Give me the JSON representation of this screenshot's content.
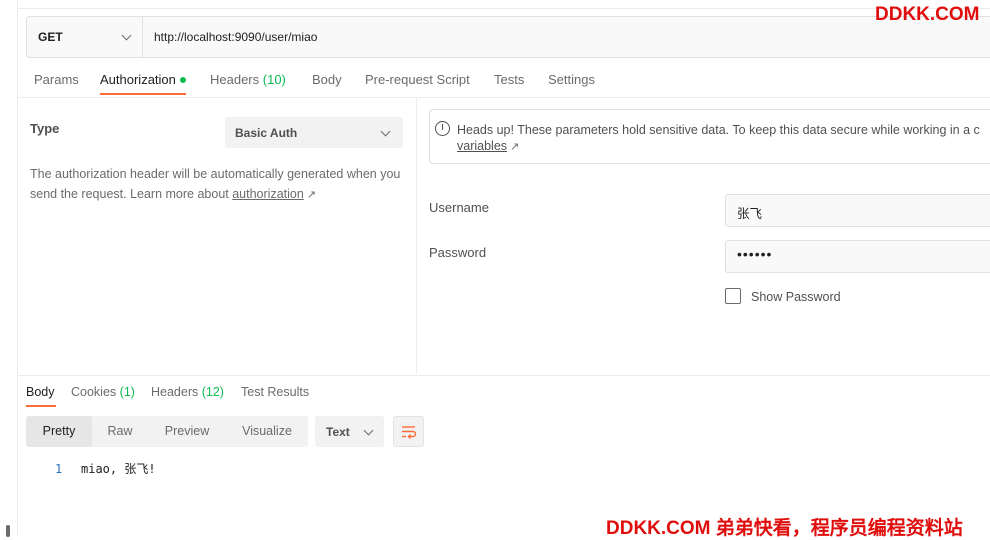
{
  "request": {
    "method": "GET",
    "url": "http://localhost:9090/user/miao"
  },
  "request_tabs": [
    {
      "label": "Params"
    },
    {
      "label": "Authorization",
      "active": true,
      "indicator": "green-dot"
    },
    {
      "label": "Headers",
      "count": "(10)"
    },
    {
      "label": "Body"
    },
    {
      "label": "Pre-request Script"
    },
    {
      "label": "Tests"
    },
    {
      "label": "Settings"
    }
  ],
  "auth": {
    "type_label": "Type",
    "type_value": "Basic Auth",
    "description": "The authorization header will be automatically generated when you send the request. Learn more about ",
    "description_link": "authorization",
    "heads_up_text": "Heads up! These parameters hold sensitive data. To keep this data secure while working in a c",
    "heads_up_link": "variables",
    "username_label": "Username",
    "username_value": "张飞",
    "password_label": "Password",
    "password_value": "••••••",
    "show_password_label": "Show Password"
  },
  "response": {
    "tabs": [
      {
        "label": "Body",
        "active": true
      },
      {
        "label": "Cookies",
        "count": "(1)"
      },
      {
        "label": "Headers",
        "count": "(12)"
      },
      {
        "label": "Test Results"
      }
    ],
    "views": [
      "Pretty",
      "Raw",
      "Preview",
      "Visualize"
    ],
    "active_view": "Pretty",
    "format": "Text",
    "body_lines": [
      {
        "number": "1",
        "text": "miao, 张飞!"
      }
    ]
  },
  "watermarks": {
    "top": "DDKK.COM",
    "bottom": "DDKK.COM 弟弟快看，程序员编程资料站"
  },
  "colors": {
    "accent": "#ff6c37",
    "success": "#0cbb52",
    "watermark": "#e00d0d"
  }
}
